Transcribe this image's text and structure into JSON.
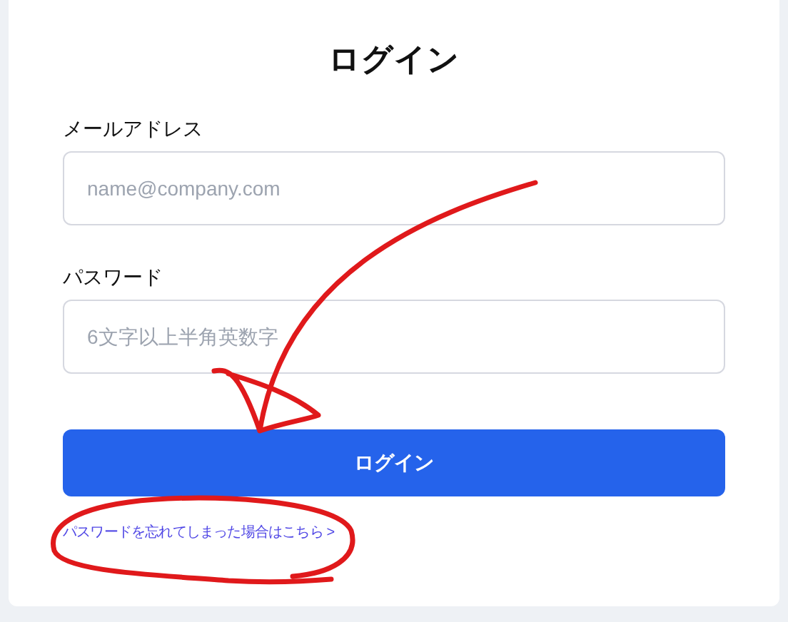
{
  "title": "ログイン",
  "fields": [
    {
      "label": "メールアドレス",
      "placeholder": "name@company.com"
    },
    {
      "label": "パスワード",
      "placeholder": "6文字以上半角英数字"
    }
  ],
  "submit": "ログイン",
  "forgot_link": "パスワードを忘れてしまった場合はこちら >"
}
